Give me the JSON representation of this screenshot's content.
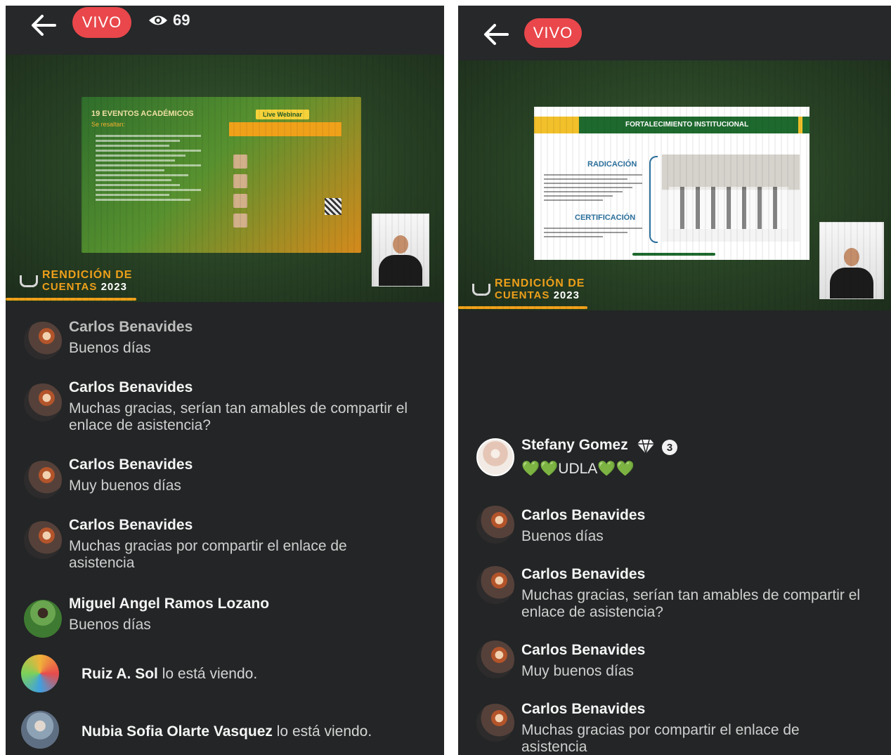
{
  "left_screen": {
    "live_label": "VIVO",
    "viewer_count": "69",
    "icons": {
      "back": "arrow-left-icon",
      "viewers": "eye-icon"
    },
    "slide": {
      "heading": "19 EVENTOS ACADÉMICOS",
      "subheading": "Se resaltan:",
      "badge": "Live Webinar"
    },
    "brand": {
      "line1": "RENDICIÓN DE",
      "line2": "CUENTAS",
      "year": "2023"
    },
    "chat": [
      {
        "type": "message",
        "name": "Carlos Benavides",
        "text": "Buenos días"
      },
      {
        "type": "message",
        "name": "Carlos Benavides",
        "text": "Muchas gracias, serían tan amables de compartir el enlace de asistencia?"
      },
      {
        "type": "message",
        "name": "Carlos Benavides",
        "text": "Muy buenos días"
      },
      {
        "type": "message",
        "name": "Carlos Benavides",
        "text": "Muchas gracias por compartir el enlace de asistencia"
      },
      {
        "type": "message",
        "name": "Miguel Angel Ramos Lozano",
        "text": "Buenos días"
      },
      {
        "type": "join",
        "name": "Ruiz A. Sol",
        "text": "lo está viendo."
      },
      {
        "type": "join",
        "name": "Nubia Sofia Olarte Vasquez",
        "text": "lo está viendo."
      }
    ]
  },
  "right_screen": {
    "live_label": "VIVO",
    "icons": {
      "back": "arrow-left-icon"
    },
    "slide": {
      "header": "FORTALECIMIENTO INSTITUCIONAL",
      "left_heading": "RADICACIÓN",
      "left_heading2": "CERTIFICACIÓN"
    },
    "brand": {
      "line1": "RENDICIÓN DE",
      "line2": "CUENTAS",
      "year": "2023"
    },
    "chat": [
      {
        "type": "message",
        "name": "Stefany Gomez",
        "badge_count": "3",
        "text": "💚💚UDLA💚💚"
      },
      {
        "type": "message",
        "name": "Carlos Benavides",
        "text": "Buenos días"
      },
      {
        "type": "message",
        "name": "Carlos Benavides",
        "text": "Muchas gracias, serían tan amables de compartir el enlace de asistencia?"
      },
      {
        "type": "message",
        "name": "Carlos Benavides",
        "text": "Muy buenos días"
      },
      {
        "type": "message",
        "name": "Carlos Benavides",
        "text": "Muchas gracias por compartir el enlace de asistencia"
      }
    ]
  },
  "colors": {
    "panel_bg": "#232526",
    "live_badge": "#e9474b",
    "brand_orange": "#f0a11a",
    "heart_green": "#58c233"
  }
}
